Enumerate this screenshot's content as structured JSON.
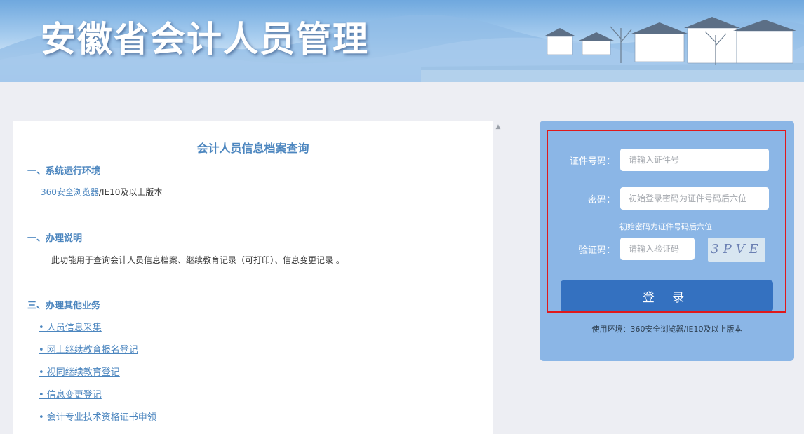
{
  "header": {
    "title": "安徽省会计人员管理"
  },
  "info": {
    "title": "会计人员信息档案查询",
    "sections": [
      {
        "heading": "一、系统运行环境",
        "link": "360安全浏览器",
        "rest": "/IE10及以上版本"
      },
      {
        "heading": "一、办理说明",
        "text": "此功能用于查询会计人员信息档案、继续教育记录（可打印）、信息变更记录 。"
      },
      {
        "heading": "三、办理其他业务"
      }
    ],
    "business_links": [
      "• 人员信息采集",
      "• 网上继续教育报名登记",
      "• 视同继续教育登记",
      "• 信息变更登记",
      "• 会计专业技术资格证书申领"
    ]
  },
  "login": {
    "id_label": "证件号码：",
    "id_placeholder": "请输入证件号",
    "password_label": "密码：",
    "password_placeholder": "初始登录密码为证件号码后六位",
    "password_hint": "初始密码为证件号码后六位",
    "captcha_label": "验证码：",
    "captcha_placeholder": "请输入验证码",
    "captcha_text": "3PVE",
    "submit_label": "登 录",
    "env_note": "使用环境：360安全浏览器/IE10及以上版本"
  },
  "colors": {
    "accent": "#4c86bf",
    "login_panel": "#8bb6e6",
    "login_button": "#3471c0",
    "highlight_frame": "#e0191b"
  }
}
